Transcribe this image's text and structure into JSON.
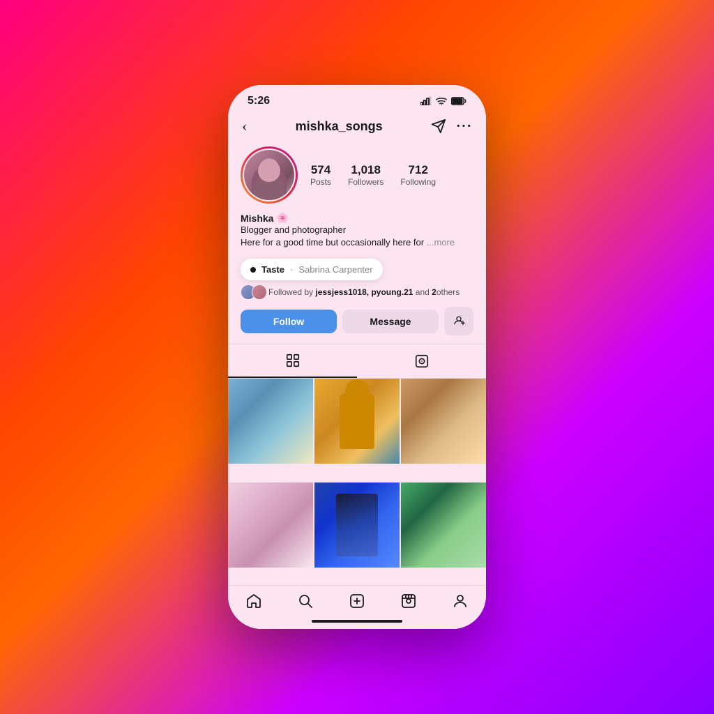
{
  "background": {
    "gradient_start": "#ff0080",
    "gradient_mid": "#ff4500",
    "gradient_end": "#8800ff"
  },
  "status_bar": {
    "time": "5:26",
    "signal": "▲▲▲",
    "wifi": "wifi",
    "battery": "battery"
  },
  "nav": {
    "username": "mishka_songs",
    "back_label": "‹",
    "send_label": "⊳",
    "more_label": "···"
  },
  "profile": {
    "name": "Mishka",
    "verified_emoji": "🌸",
    "bio_line1": "Blogger and photographer",
    "bio_line2": "Here for a good time but occasionally here for ",
    "bio_more": "...more",
    "stats": {
      "posts_count": "574",
      "posts_label": "Posts",
      "followers_count": "1,018",
      "followers_label": "Followers",
      "following_count": "712",
      "following_label": "Following"
    },
    "music": {
      "song": "Taste",
      "separator": "·",
      "artist": "Sabrina Carpenter"
    },
    "followed_by": {
      "text_prefix": "Followed by ",
      "users": "jessjess1018, pyoung.21",
      "text_suffix": " and ",
      "others_count": "2",
      "others_label": "others"
    },
    "buttons": {
      "follow": "Follow",
      "message": "Message"
    }
  },
  "tabs": {
    "grid_tab": "grid",
    "tagged_tab": "tagged"
  },
  "bottom_nav": {
    "home": "home",
    "search": "search",
    "create": "create",
    "reels": "reels",
    "profile": "profile"
  },
  "grid": {
    "cells": [
      {
        "id": 1,
        "color_class": "grid-cell-1"
      },
      {
        "id": 2,
        "color_class": "grid-cell-2"
      },
      {
        "id": 3,
        "color_class": "grid-cell-3"
      },
      {
        "id": 4,
        "color_class": "grid-cell-4"
      },
      {
        "id": 5,
        "color_class": "grid-cell-5"
      },
      {
        "id": 6,
        "color_class": "grid-cell-6"
      }
    ]
  }
}
